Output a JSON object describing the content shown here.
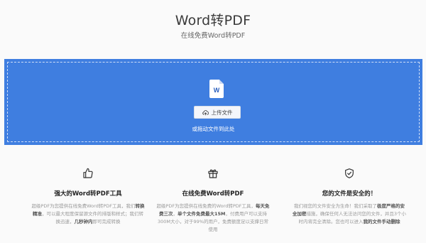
{
  "hero": {
    "title": "Word转PDF",
    "subtitle": "在线免费Word转PDF"
  },
  "dropzone": {
    "file_icon_letter": "W",
    "upload_button_label": "上传文件",
    "drag_hint": "或拖动文件到此处",
    "accent_color": "#3f7ee0"
  },
  "features": [
    {
      "icon": "thumbs-up-icon",
      "title": "强大的Word转PDF工具",
      "desc_parts": [
        {
          "text": "超级PDF为您提供在线免费Word转PDF工具，我们",
          "bold": false
        },
        {
          "text": "转换精准",
          "bold": true
        },
        {
          "text": "，可以最大程度保留源文件的排版和样式；我们转换迅速，",
          "bold": false
        },
        {
          "text": "几秒钟内",
          "bold": true
        },
        {
          "text": "即可完成转换",
          "bold": false
        }
      ]
    },
    {
      "icon": "gift-icon",
      "title": "在线免费Word转PDF",
      "desc_parts": [
        {
          "text": "超级PDF为您提供在线免费的Word转PDF工具，",
          "bold": false
        },
        {
          "text": "每天免费三次",
          "bold": true
        },
        {
          "text": "，",
          "bold": false
        },
        {
          "text": "单个文件免费最大15M",
          "bold": true
        },
        {
          "text": "，付费用户可以支持300M大小，对于99%的用户，免费额度足以支撑日常使用",
          "bold": false
        }
      ]
    },
    {
      "icon": "shield-check-icon",
      "title": "您的文件是安全的！",
      "desc_parts": [
        {
          "text": "我们视您的文件安全为生命！我们采取了",
          "bold": false
        },
        {
          "text": "极度严格的安全加密",
          "bold": true
        },
        {
          "text": "措施，确保任何人无法访问您的文件，并且3个小时内将完全清除。您也可以进入",
          "bold": false
        },
        {
          "text": "我的文件手动删除",
          "bold": true
        }
      ]
    }
  ]
}
